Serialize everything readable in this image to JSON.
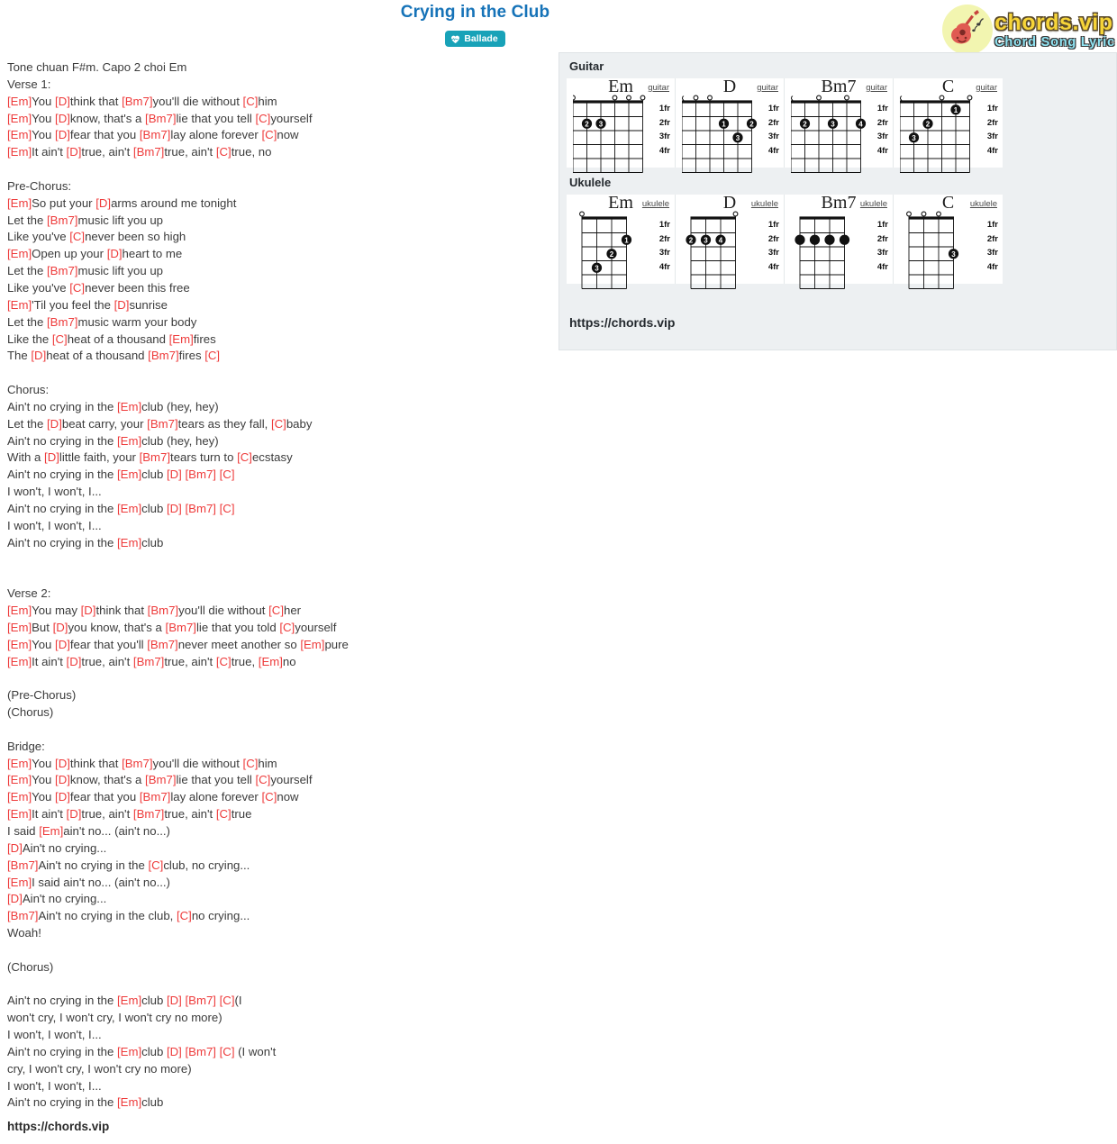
{
  "header": {
    "title": "Crying in the Club",
    "badge_label": "Ballade",
    "badge_icon": "heart-pulse-icon",
    "badge_color": "#18a2b8",
    "title_color": "#1673b8"
  },
  "logo": {
    "main": "chords.vip",
    "sub": "Chord Song Lyric",
    "icon": "guitar-icon"
  },
  "lyrics": {
    "tone_note": "Tone chuan F#m. Capo 2 choi Em",
    "lines": [
      {
        "t": "plain",
        "text": "Tone chuan F#m. Capo 2 choi Em"
      },
      {
        "t": "plain",
        "text": "Verse 1:"
      },
      {
        "t": "chords",
        "text": "[Em]You [D]think that [Bm7]you'll die without [C]him"
      },
      {
        "t": "chords",
        "text": "[Em]You [D]know, that's a [Bm7]lie that you tell [C]yourself"
      },
      {
        "t": "chords",
        "text": "[Em]You [D]fear that you [Bm7]lay alone forever [C]now"
      },
      {
        "t": "chords",
        "text": "[Em]It ain't [D]true, ain't [Bm7]true, ain't [C]true, no"
      },
      {
        "t": "blank",
        "text": ""
      },
      {
        "t": "plain",
        "text": "Pre-Chorus:"
      },
      {
        "t": "chords",
        "text": "[Em]So put your [D]arms around me tonight"
      },
      {
        "t": "chords",
        "text": "Let the [Bm7]music lift you up"
      },
      {
        "t": "chords",
        "text": "Like you've [C]never been so high"
      },
      {
        "t": "chords",
        "text": "[Em]Open up your [D]heart to me"
      },
      {
        "t": "chords",
        "text": "Let the [Bm7]music lift you up"
      },
      {
        "t": "chords",
        "text": "Like you've [C]never been this free"
      },
      {
        "t": "chords",
        "text": "[Em]'Til you feel the [D]sunrise"
      },
      {
        "t": "chords",
        "text": "Let the [Bm7]music warm your body"
      },
      {
        "t": "chords",
        "text": "Like the [C]heat of a thousand [Em]fires"
      },
      {
        "t": "chords",
        "text": "The [D]heat of a thousand [Bm7]fires [C]"
      },
      {
        "t": "blank",
        "text": ""
      },
      {
        "t": "plain",
        "text": "Chorus:"
      },
      {
        "t": "chords",
        "text": "Ain't no crying in the [Em]club (hey, hey)"
      },
      {
        "t": "chords",
        "text": "Let the [D]beat carry, your [Bm7]tears as they fall, [C]baby"
      },
      {
        "t": "chords",
        "text": "Ain't no crying in the [Em]club (hey, hey)"
      },
      {
        "t": "chords",
        "text": "With a [D]little faith, your [Bm7]tears turn to [C]ecstasy"
      },
      {
        "t": "chords",
        "text": "Ain't no crying in the [Em]club [D] [Bm7] [C]"
      },
      {
        "t": "plain",
        "text": "I won't, I won't, I..."
      },
      {
        "t": "chords",
        "text": "Ain't no crying in the [Em]club [D] [Bm7] [C]"
      },
      {
        "t": "plain",
        "text": "I won't, I won't, I..."
      },
      {
        "t": "chords",
        "text": "Ain't no crying in the [Em]club"
      },
      {
        "t": "blank",
        "text": ""
      },
      {
        "t": "blank",
        "text": ""
      },
      {
        "t": "plain",
        "text": "Verse 2:"
      },
      {
        "t": "chords",
        "text": "[Em]You may [D]think that [Bm7]you'll die without [C]her"
      },
      {
        "t": "chords",
        "text": "[Em]But [D]you know, that's a [Bm7]lie that you told [C]yourself"
      },
      {
        "t": "chords",
        "text": "[Em]You [D]fear that you'll [Bm7]never meet another so [Em]pure"
      },
      {
        "t": "chords",
        "text": "[Em]It ain't [D]true, ain't [Bm7]true, ain't [C]true, [Em]no"
      },
      {
        "t": "blank",
        "text": ""
      },
      {
        "t": "plain",
        "text": "(Pre-Chorus)"
      },
      {
        "t": "plain",
        "text": "(Chorus)"
      },
      {
        "t": "blank",
        "text": ""
      },
      {
        "t": "plain",
        "text": "Bridge:"
      },
      {
        "t": "chords",
        "text": "[Em]You [D]think that [Bm7]you'll die without [C]him"
      },
      {
        "t": "chords",
        "text": "[Em]You [D]know, that's a [Bm7]lie that you tell [C]yourself"
      },
      {
        "t": "chords",
        "text": "[Em]You [D]fear that you [Bm7]lay alone forever [C]now"
      },
      {
        "t": "chords",
        "text": "[Em]It ain't [D]true, ain't [Bm7]true, ain't [C]true"
      },
      {
        "t": "chords",
        "text": "I said [Em]ain't no... (ain't no...)"
      },
      {
        "t": "chords",
        "text": "[D]Ain't no crying..."
      },
      {
        "t": "chords",
        "text": "[Bm7]Ain't no crying in the [C]club, no crying..."
      },
      {
        "t": "chords",
        "text": "[Em]I said ain't no... (ain't no...)"
      },
      {
        "t": "chords",
        "text": "[D]Ain't no crying..."
      },
      {
        "t": "chords",
        "text": "[Bm7]Ain't no crying in the club, [C]no crying..."
      },
      {
        "t": "plain",
        "text": "Woah!"
      },
      {
        "t": "blank",
        "text": ""
      },
      {
        "t": "plain",
        "text": "(Chorus)"
      },
      {
        "t": "blank",
        "text": ""
      },
      {
        "t": "chords",
        "text": "Ain't no crying in the [Em]club [D] [Bm7] [C](I"
      },
      {
        "t": "plain",
        "text": "won't cry, I won't cry, I won't cry no more)"
      },
      {
        "t": "plain",
        "text": "I won't, I won't, I..."
      },
      {
        "t": "chords",
        "text": "Ain't no crying in the [Em]club [D] [Bm7] [C] (I won't"
      },
      {
        "t": "plain",
        "text": "cry, I won't cry, I won't cry no more)"
      },
      {
        "t": "plain",
        "text": "I won't, I won't, I..."
      },
      {
        "t": "chords",
        "text": "Ain't no crying in the [Em]club"
      }
    ],
    "footer_url": "https://chords.vip",
    "chord_color": "#ee3b3b"
  },
  "chord_panel": {
    "url": "https://chords.vip",
    "sections": [
      {
        "label": "Guitar",
        "instrument": "guitar",
        "strings": 6,
        "fret_labels": [
          "1fr",
          "2fr",
          "3fr",
          "4fr"
        ],
        "chords": [
          {
            "name": "Em",
            "instrument_label": "guitar",
            "top_markers": [
              "o",
              "",
              "",
              "o",
              "o",
              "o"
            ],
            "dots": [
              {
                "string": 2,
                "fret": 2,
                "finger": "2"
              },
              {
                "string": 3,
                "fret": 2,
                "finger": "3"
              }
            ]
          },
          {
            "name": "D",
            "instrument_label": "guitar",
            "top_markers": [
              "x",
              "o",
              "o",
              "",
              "",
              ""
            ],
            "dots": [
              {
                "string": 4,
                "fret": 2,
                "finger": "1"
              },
              {
                "string": 6,
                "fret": 2,
                "finger": "2"
              },
              {
                "string": 5,
                "fret": 3,
                "finger": "3"
              }
            ]
          },
          {
            "name": "Bm7",
            "instrument_label": "guitar",
            "top_markers": [
              "x",
              "",
              "o",
              "",
              "o",
              ""
            ],
            "dots": [
              {
                "string": 2,
                "fret": 2,
                "finger": "2"
              },
              {
                "string": 4,
                "fret": 2,
                "finger": "3"
              },
              {
                "string": 6,
                "fret": 2,
                "finger": "4"
              }
            ]
          },
          {
            "name": "C",
            "instrument_label": "guitar",
            "top_markers": [
              "x",
              "",
              "",
              "o",
              "",
              "o"
            ],
            "dots": [
              {
                "string": 5,
                "fret": 1,
                "finger": "1"
              },
              {
                "string": 3,
                "fret": 2,
                "finger": "2"
              },
              {
                "string": 2,
                "fret": 3,
                "finger": "3"
              }
            ]
          }
        ]
      },
      {
        "label": "Ukulele",
        "instrument": "ukulele",
        "strings": 4,
        "fret_labels": [
          "1fr",
          "2fr",
          "3fr",
          "4fr"
        ],
        "chords": [
          {
            "name": "Em",
            "instrument_label": "ukulele",
            "top_markers": [
              "o",
              "",
              "",
              ""
            ],
            "dots": [
              {
                "string": 4,
                "fret": 2,
                "finger": "1"
              },
              {
                "string": 3,
                "fret": 3,
                "finger": "2"
              },
              {
                "string": 2,
                "fret": 4,
                "finger": "3"
              }
            ]
          },
          {
            "name": "D",
            "instrument_label": "ukulele",
            "top_markers": [
              "",
              "",
              "",
              "o"
            ],
            "dots": [
              {
                "string": 1,
                "fret": 2,
                "finger": "2"
              },
              {
                "string": 2,
                "fret": 2,
                "finger": "3"
              },
              {
                "string": 3,
                "fret": 2,
                "finger": "4"
              }
            ]
          },
          {
            "name": "Bm7",
            "instrument_label": "ukulele",
            "top_markers": [
              "",
              "",
              "",
              ""
            ],
            "dots": [
              {
                "string": 1,
                "fret": 2,
                "finger": ""
              },
              {
                "string": 2,
                "fret": 2,
                "finger": ""
              },
              {
                "string": 3,
                "fret": 2,
                "finger": ""
              },
              {
                "string": 4,
                "fret": 2,
                "finger": ""
              }
            ]
          },
          {
            "name": "C",
            "instrument_label": "ukulele",
            "top_markers": [
              "o",
              "o",
              "o",
              ""
            ],
            "dots": [
              {
                "string": 4,
                "fret": 3,
                "finger": "3"
              }
            ]
          }
        ]
      }
    ]
  }
}
